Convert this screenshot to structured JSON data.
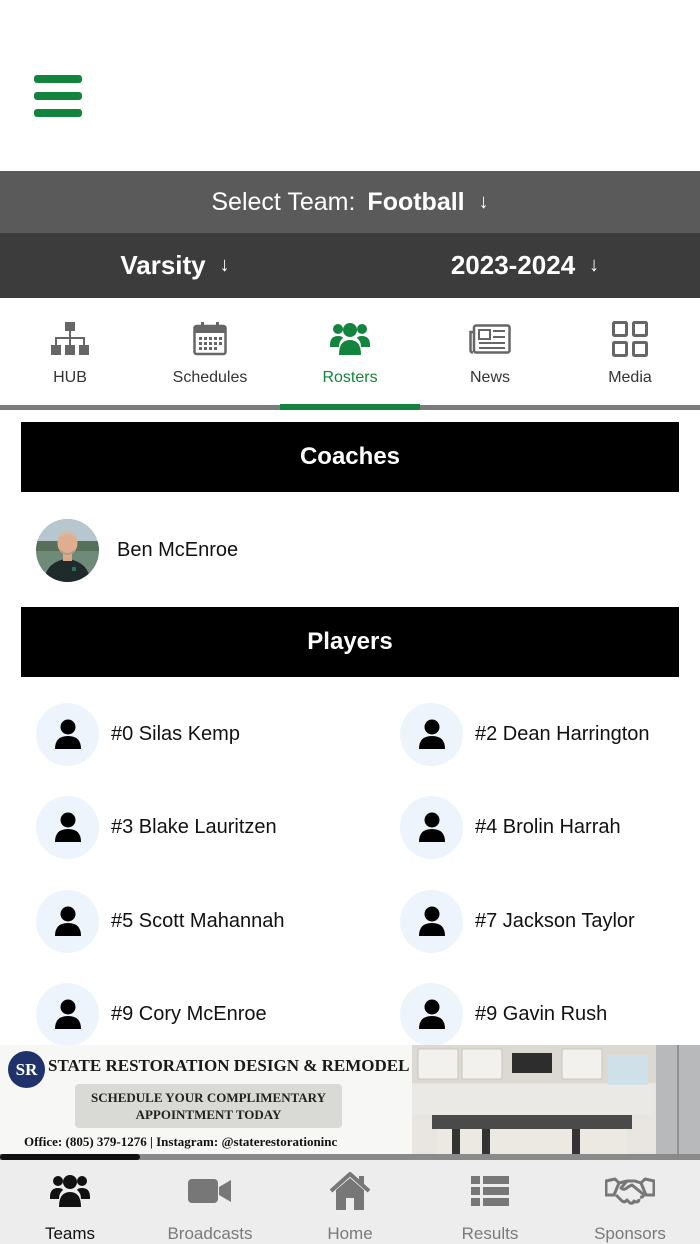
{
  "colors": {
    "accent": "#13843d",
    "team_bar": "#5a5a5a",
    "filter_bar": "#3c3c3c",
    "section_head": "#000000",
    "nav_bg": "#ededed"
  },
  "header": {
    "menu_icon": "hamburger-menu-icon"
  },
  "team_selector": {
    "label": "Select Team:",
    "value": "Football",
    "icon": "arrow-down-icon"
  },
  "filters": {
    "level": {
      "value": "Varsity",
      "icon": "arrow-down-icon"
    },
    "season": {
      "value": "2023-2024",
      "icon": "arrow-down-icon"
    }
  },
  "tabs": [
    {
      "label": "HUB",
      "icon": "org-chart-icon"
    },
    {
      "label": "Schedules",
      "icon": "calendar-icon"
    },
    {
      "label": "Rosters",
      "icon": "users-icon",
      "active": true
    },
    {
      "label": "News",
      "icon": "newspaper-icon"
    },
    {
      "label": "Media",
      "icon": "grid-icon"
    }
  ],
  "coaches": {
    "heading": "Coaches",
    "items": [
      {
        "name": "Ben McEnroe"
      }
    ]
  },
  "players": {
    "heading": "Players",
    "items": [
      {
        "name": "#0 Silas Kemp"
      },
      {
        "name": "#2 Dean Harrington"
      },
      {
        "name": "#3 Blake Lauritzen"
      },
      {
        "name": "#4 Brolin Harrah"
      },
      {
        "name": "#5 Scott Mahannah"
      },
      {
        "name": "#7 Jackson Taylor"
      },
      {
        "name": "#9 Cory McEnroe"
      },
      {
        "name": "#9 Gavin Rush"
      }
    ]
  },
  "ad": {
    "logo_text": "SR",
    "title": "STATE RESTORATION DESIGN & REMODEL",
    "cta_line1": "SCHEDULE YOUR COMPLIMENTARY",
    "cta_line2": "APPOINTMENT TODAY",
    "contact": "Office: (805) 379-1276 | Instagram: @staterestorationinc",
    "carousel_progress": 0.2
  },
  "bottom_nav": [
    {
      "label": "Teams",
      "icon": "teams-icon",
      "active": true
    },
    {
      "label": "Broadcasts",
      "icon": "video-camera-icon"
    },
    {
      "label": "Home",
      "icon": "home-icon"
    },
    {
      "label": "Results",
      "icon": "list-icon"
    },
    {
      "label": "Sponsors",
      "icon": "handshake-icon"
    }
  ]
}
